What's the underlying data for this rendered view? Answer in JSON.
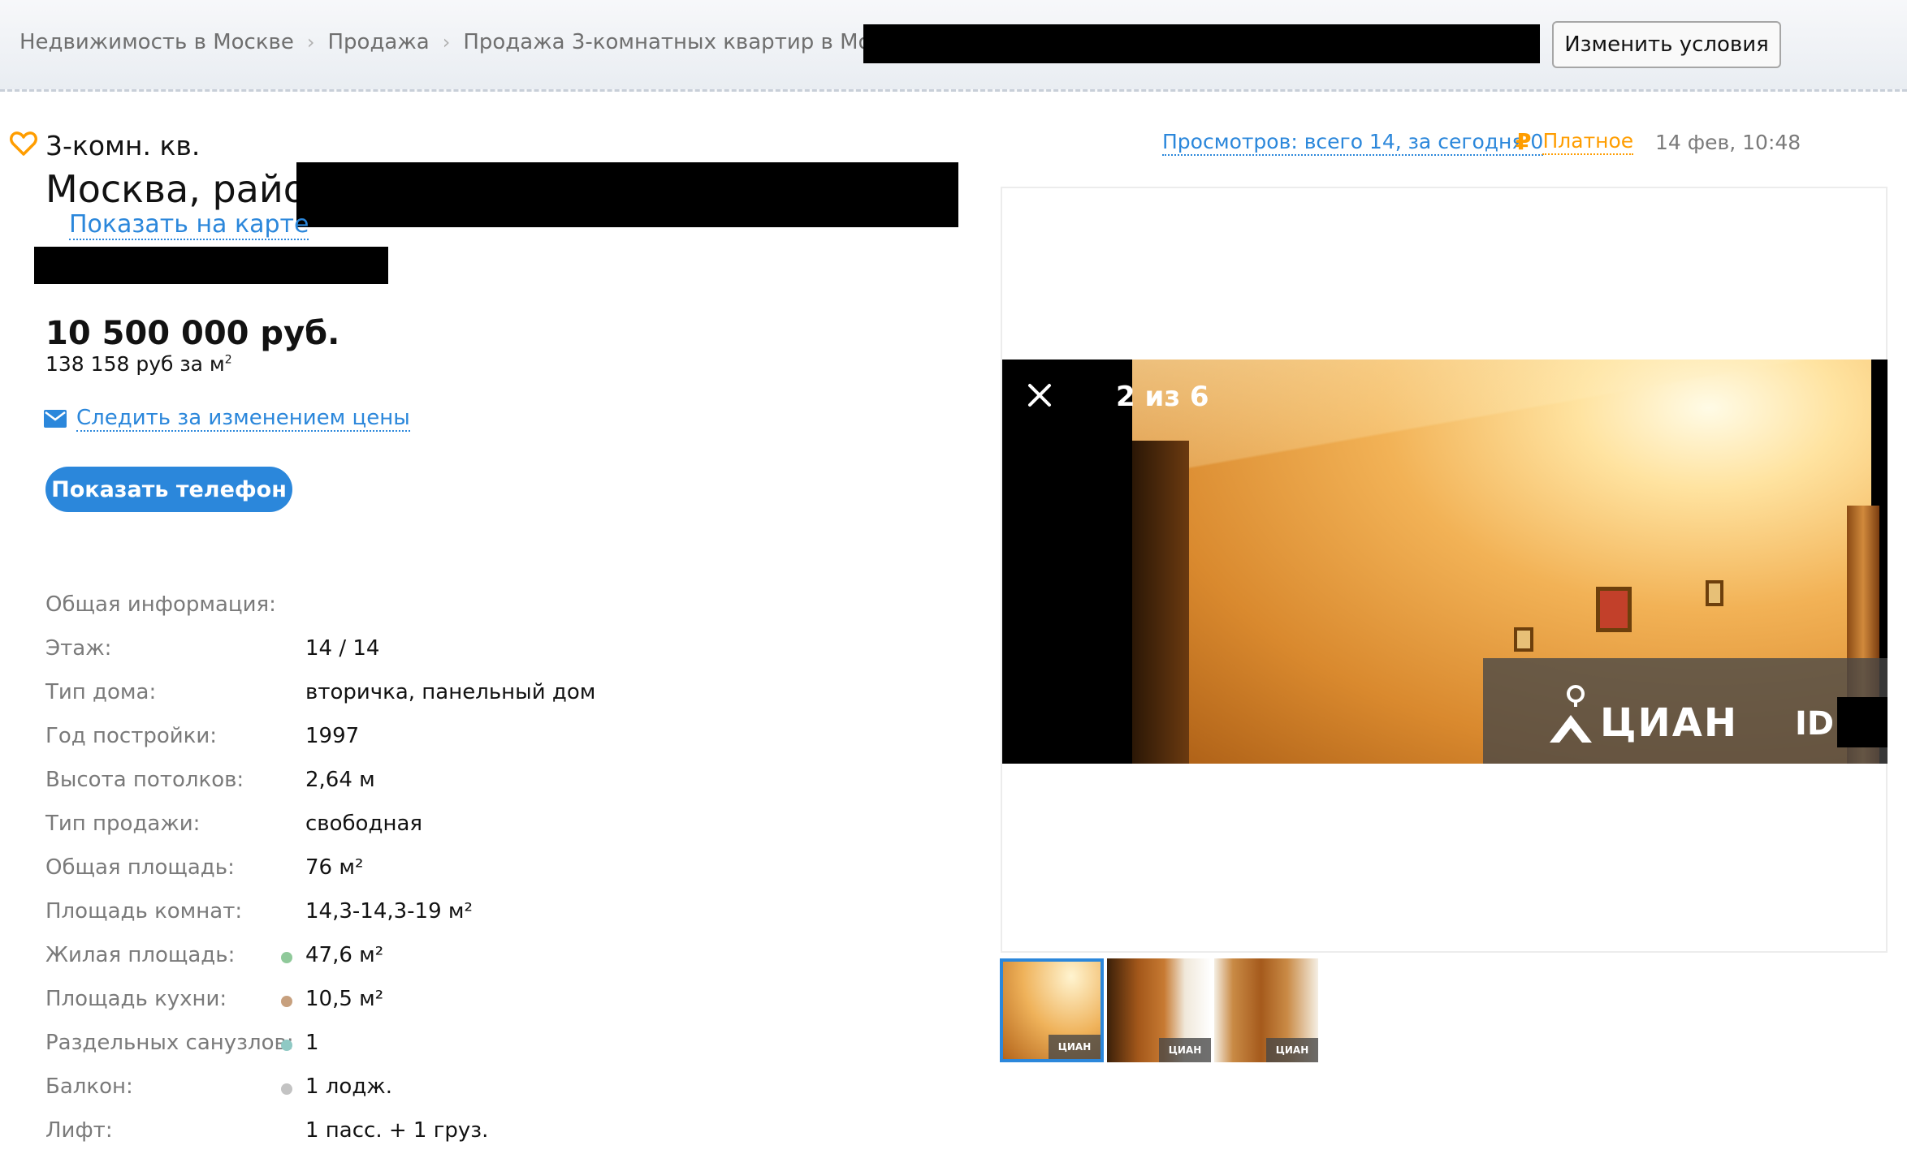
{
  "breadcrumbs": [
    "Недвижимость в Москве",
    "Продажа",
    "Продажа 3-комнатных квартир в Москве"
  ],
  "breadcrumb_separator": "›",
  "change_button": "Изменить условия",
  "listing": {
    "rooms": "3-комн. кв.",
    "address": "Москва, район",
    "map_link": "Показать на карте",
    "price": "10 500 000 руб.",
    "price_per_m2": "138 158 руб за м",
    "price_per_m2_sup": "2",
    "watch_price": "Следить за изменением цены",
    "phone_button": "Показать телефон"
  },
  "meta": {
    "views": "Просмотров: всего 14, за сегодня 0",
    "paid": "Платное",
    "ruble_icon": "₽",
    "date": "14 фев, 10:48"
  },
  "info": {
    "title": "Общая информация:",
    "rows": [
      {
        "label": "Этаж:",
        "value": "14 / 14",
        "dot": ""
      },
      {
        "label": "Тип дома:",
        "value": "вторичка, панельный дом",
        "dot": ""
      },
      {
        "label": "Год постройки:",
        "value": "1997",
        "dot": ""
      },
      {
        "label": "Высота потолков:",
        "value": "2,64 м",
        "dot": ""
      },
      {
        "label": "Тип продажи:",
        "value": "свободная",
        "dot": ""
      },
      {
        "label": "Общая площадь:",
        "value": "76 м²",
        "dot": ""
      },
      {
        "label": "Площадь комнат:",
        "value": "14,3-14,3-19 м²",
        "dot": ""
      },
      {
        "label": "Жилая площадь:",
        "value": "47,6 м²",
        "dot": "#8fc99a"
      },
      {
        "label": "Площадь кухни:",
        "value": "10,5 м²",
        "dot": "#c7a07e"
      },
      {
        "label": "Раздельных санузлов:",
        "value": "1",
        "dot": "#8fc9c4"
      },
      {
        "label": "Балкон:",
        "value": "1 лодж.",
        "dot": "#c3c3c3"
      },
      {
        "label": "Лифт:",
        "value": "1 пасс. + 1 груз.",
        "dot": ""
      }
    ]
  },
  "gallery": {
    "counter": "2 из 6",
    "watermark": "ЦИАН",
    "watermark_id": "ID",
    "thumb_watermark": "ЦИАН"
  },
  "colors": {
    "accent_blue": "#2b87db",
    "paid_orange": "#ff9d00"
  }
}
